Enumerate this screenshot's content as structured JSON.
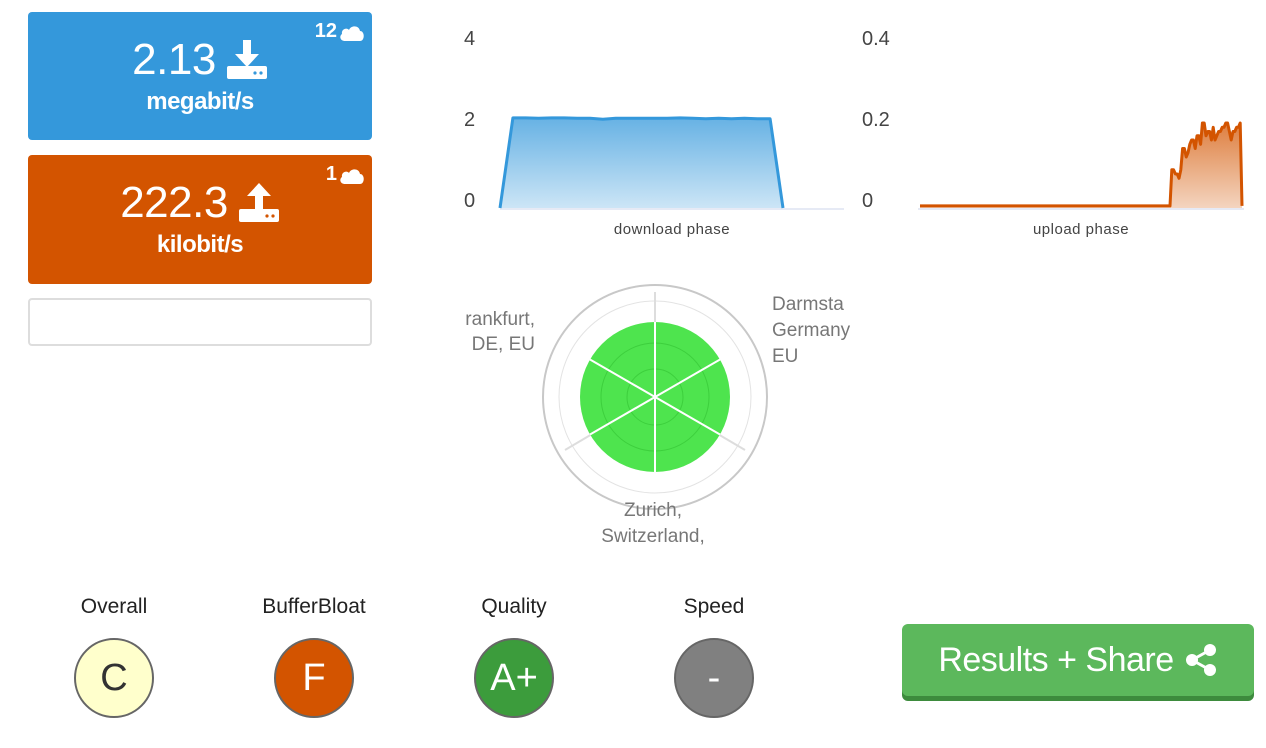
{
  "download": {
    "value": "2.13",
    "unit": "megabit/s",
    "server_count": "12",
    "icon": "download-icon"
  },
  "upload": {
    "value": "222.3",
    "unit": "kilobit/s",
    "server_count": "1",
    "icon": "upload-icon"
  },
  "download_chart": {
    "label": "download phase",
    "y_ticks": [
      "4",
      "2",
      "0"
    ],
    "ylim": [
      0,
      4
    ],
    "color": "#3498db",
    "values": [
      0,
      2.12,
      2.12,
      2.11,
      2.12,
      2.12,
      2.11,
      2.11,
      2.09,
      2.11,
      2.11,
      2.11,
      2.11,
      2.11,
      2.12,
      2.11,
      2.1,
      2.11,
      2.1,
      2.11,
      2.1,
      2.1,
      0
    ]
  },
  "upload_chart": {
    "label": "upload phase",
    "y_ticks": [
      "0.4",
      "0.2",
      "0"
    ],
    "ylim": [
      0,
      0.4
    ],
    "color": "#d35400",
    "values": [
      0.005,
      0.005,
      0.005,
      0.005,
      0.005,
      0.005,
      0.005,
      0.005,
      0.005,
      0.005,
      0.005,
      0.005,
      0.005,
      0.005,
      0.005,
      0.005,
      0.005,
      0.005,
      0.005,
      0.005,
      0.005,
      0.005,
      0.005,
      0.005,
      0.005,
      0.005,
      0.005,
      0.005,
      0.005,
      0.005,
      0.005,
      0.005,
      0.005,
      0.005,
      0.005,
      0.005,
      0.005,
      0.005,
      0.005,
      0.005,
      0.005,
      0.005,
      0.005,
      0.005,
      0.005,
      0.005,
      0.005,
      0.005,
      0.005,
      0.005,
      0.005,
      0.005,
      0.005,
      0.005,
      0.005,
      0.005,
      0.005,
      0.005,
      0.005,
      0.005,
      0.005,
      0.005,
      0.005,
      0.005,
      0.005,
      0.005,
      0.005,
      0.005,
      0.005,
      0.005,
      0.005,
      0.005,
      0.005,
      0.005,
      0.005,
      0.005,
      0.005,
      0.005,
      0.005,
      0.005,
      0.005,
      0.005,
      0.005,
      0.005,
      0.005,
      0.005,
      0.005,
      0.005,
      0.005,
      0.005,
      0.005,
      0.005,
      0.005,
      0.005,
      0.005,
      0.005,
      0.005,
      0.005,
      0.005,
      0.005,
      0.005,
      0.005,
      0.005,
      0.005,
      0.005,
      0.005,
      0.005,
      0.005,
      0.005,
      0.005,
      0.005,
      0.005,
      0.005,
      0.005,
      0.005,
      0.005,
      0.005,
      0.005,
      0.005,
      0.005,
      0.005,
      0.005,
      0.005,
      0.005,
      0.005,
      0.005,
      0.005,
      0.005,
      0.005,
      0.005,
      0.005,
      0.005,
      0.005,
      0.005,
      0.005,
      0.005,
      0.005,
      0.005,
      0.005,
      0.005,
      0.09,
      0.09,
      0.08,
      0.08,
      0.07,
      0.09,
      0.14,
      0.14,
      0.12,
      0.13,
      0.15,
      0.16,
      0.16,
      0.14,
      0.17,
      0.17,
      0.15,
      0.2,
      0.2,
      0.17,
      0.18,
      0.18,
      0.16,
      0.19,
      0.16,
      0.17,
      0.18,
      0.18,
      0.19,
      0.19,
      0.2,
      0.2,
      0.18,
      0.16,
      0.18,
      0.18,
      0.19,
      0.19,
      0.2,
      0.005
    ]
  },
  "radar": {
    "labels": [
      {
        "lines": [
          "rankfurt,",
          "DE, EU"
        ],
        "anchor": "end"
      },
      {
        "lines": [
          "Darmsta",
          "Germany",
          "EU"
        ],
        "anchor": "start"
      },
      {
        "lines": [
          "Zurich,",
          "Switzerland,"
        ],
        "anchor": "middle"
      }
    ],
    "fill_color": "#4ee44e"
  },
  "grades": [
    {
      "title": "Overall",
      "grade": "C",
      "bg": "#ffffcc",
      "fg": "#333333"
    },
    {
      "title": "BufferBloat",
      "grade": "F",
      "bg": "#d35400",
      "fg": "#ffffff"
    },
    {
      "title": "Quality",
      "grade": "A+",
      "bg": "#3c9c3c",
      "fg": "#ffffff"
    },
    {
      "title": "Speed",
      "grade": "-",
      "bg": "#808080",
      "fg": "#ffffff"
    }
  ],
  "share_button": {
    "label": "Results + Share",
    "icon": "share-icon"
  }
}
